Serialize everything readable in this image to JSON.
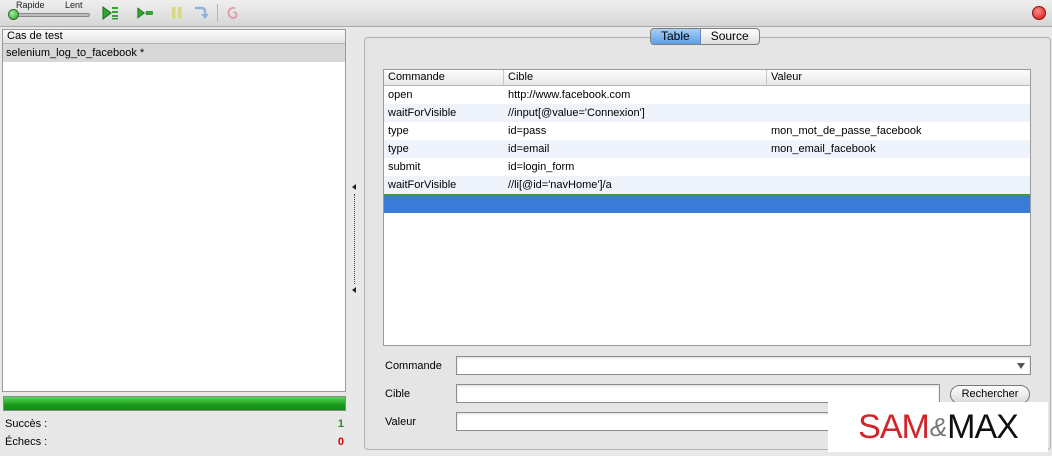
{
  "toolbar": {
    "speed_fast": "Rapide",
    "speed_slow": "Lent",
    "speed_level": 0.0
  },
  "test_cases": {
    "header": "Cas de test",
    "items": [
      "selenium_log_to_facebook *"
    ]
  },
  "progress": {
    "fraction": 1.0,
    "success_label": "Succès :",
    "success_count": "1",
    "failure_label": "Échecs :",
    "failure_count": "0",
    "success_color": "#2a8a2a",
    "failure_color": "#d40000"
  },
  "tabs": {
    "table": "Table",
    "source": "Source",
    "active": "Table"
  },
  "table": {
    "headers": [
      "Commande",
      "Cible",
      "Valeur"
    ],
    "rows": [
      [
        "open",
        "http://www.facebook.com",
        ""
      ],
      [
        "waitForVisible",
        "//input[@value='Connexion']",
        ""
      ],
      [
        "type",
        "id=pass",
        "mon_mot_de_passe_facebook"
      ],
      [
        "type",
        "id=email",
        "mon_email_facebook"
      ],
      [
        "submit",
        "id=login_form",
        ""
      ],
      [
        "waitForVisible",
        "//li[@id='navHome']/a",
        ""
      ]
    ],
    "selection_color": "#3a7bd7"
  },
  "form": {
    "command_label": "Commande",
    "command_value": "",
    "target_label": "Cible",
    "target_value": "",
    "value_label": "Valeur",
    "value_value": "",
    "search_button": "Rechercher"
  },
  "logo": {
    "part1": "SAM",
    "amp": "&",
    "part2": "MAX"
  }
}
